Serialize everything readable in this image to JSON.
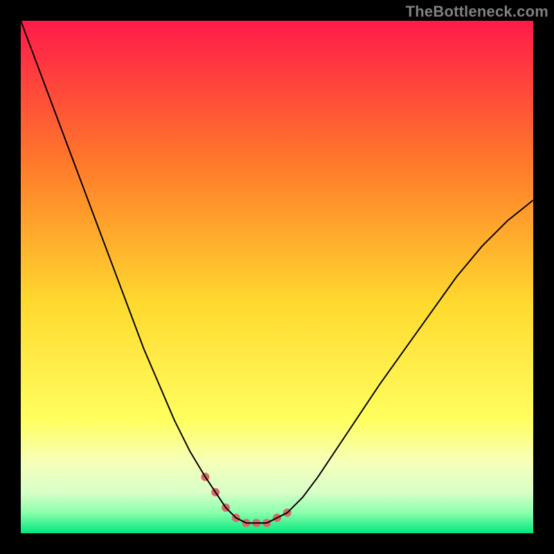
{
  "watermark": "TheBottleneck.com",
  "chart_data": {
    "type": "line",
    "title": "",
    "xlabel": "",
    "ylabel": "",
    "xlim": [
      0,
      100
    ],
    "ylim": [
      0,
      100
    ],
    "background_gradient": {
      "top": "#ff1a4a",
      "mid_upper": "#ff8a2a",
      "mid": "#ffe62e",
      "mid_lower": "#f8ffb0",
      "bottom_band": "#e8ffc0",
      "bottom": "#00e77f"
    },
    "series": [
      {
        "name": "bottleneck-curve",
        "color": "#000000",
        "width": 2,
        "x": [
          0,
          3,
          6,
          9,
          12,
          15,
          18,
          21,
          24,
          27,
          30,
          33,
          36,
          38,
          40,
          42,
          44,
          46,
          48,
          50,
          52,
          55,
          58,
          62,
          66,
          70,
          75,
          80,
          85,
          90,
          95,
          100
        ],
        "values": [
          100,
          92,
          84,
          76,
          68,
          60,
          52,
          44,
          36,
          29,
          22,
          16,
          11,
          8,
          5,
          3,
          2,
          2,
          2,
          3,
          4,
          7,
          11,
          17,
          23,
          29,
          36,
          43,
          50,
          56,
          61,
          65
        ]
      }
    ],
    "markers": {
      "name": "highlight-dots",
      "color": "#d96a6a",
      "radius": 6,
      "x": [
        36,
        38,
        40,
        42,
        44,
        46,
        48,
        50,
        52
      ],
      "values": [
        11,
        8,
        5,
        3,
        2,
        2,
        2,
        3,
        4
      ]
    }
  }
}
